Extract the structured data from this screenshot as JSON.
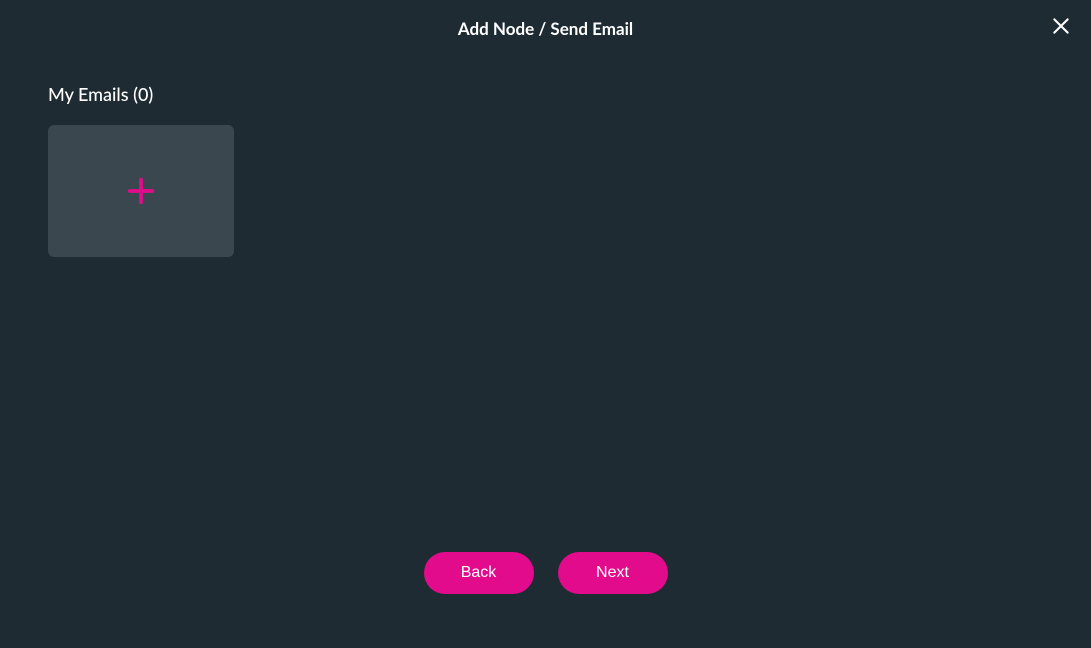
{
  "header": {
    "title": "Add Node / Send Email"
  },
  "section": {
    "title": "My Emails (0)"
  },
  "footer": {
    "back_label": "Back",
    "next_label": "Next"
  },
  "colors": {
    "accent": "#e20b8c",
    "background": "#1e2b33",
    "card": "#3a474f"
  }
}
